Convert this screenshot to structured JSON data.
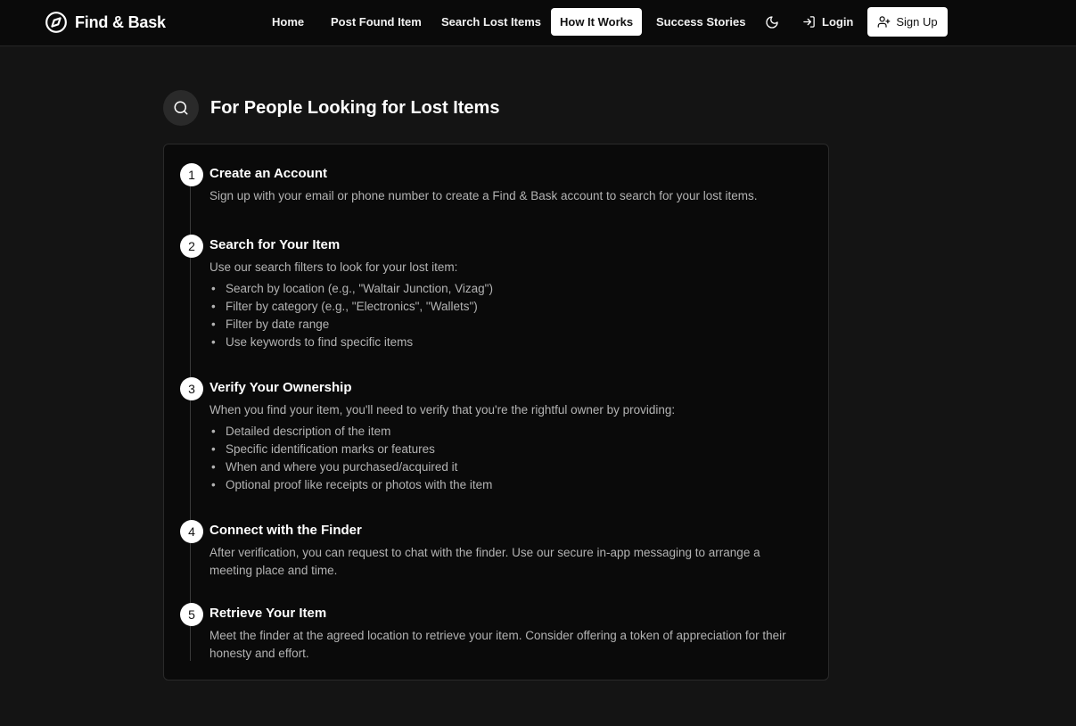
{
  "brand": {
    "name": "Find & Bask",
    "icon": "compass-icon"
  },
  "nav": {
    "items": [
      {
        "label": "Home"
      },
      {
        "label": "Post Found Item"
      },
      {
        "label": "Search Lost Items"
      },
      {
        "label": "How It Works",
        "active": true
      },
      {
        "label": "Success Stories"
      }
    ],
    "theme_toggle_icon": "moon-icon",
    "login_label": "Login",
    "login_icon": "log-in-icon",
    "signup_label": "Sign Up",
    "signup_icon": "user-plus-icon"
  },
  "section": {
    "icon": "search-icon",
    "title": "For People Looking for Lost Items"
  },
  "steps": [
    {
      "number": "1",
      "title": "Create an Account",
      "description": "Sign up with your email or phone number to create a Find & Bask account to search for your lost items.",
      "bullets": []
    },
    {
      "number": "2",
      "title": "Search for Your Item",
      "description": "Use our search filters to look for your lost item:",
      "bullets": [
        "Search by location (e.g., \"Waltair Junction, Vizag\")",
        "Filter by category (e.g., \"Electronics\", \"Wallets\")",
        "Filter by date range",
        "Use keywords to find specific items"
      ]
    },
    {
      "number": "3",
      "title": "Verify Your Ownership",
      "description": "When you find your item, you'll need to verify that you're the rightful owner by providing:",
      "bullets": [
        "Detailed description of the item",
        "Specific identification marks or features",
        "When and where you purchased/acquired it",
        "Optional proof like receipts or photos with the item"
      ]
    },
    {
      "number": "4",
      "title": "Connect with the Finder",
      "description": "After verification, you can request to chat with the finder. Use our secure in-app messaging to arrange a meeting place and time.",
      "bullets": []
    },
    {
      "number": "5",
      "title": "Retrieve Your Item",
      "description": "Meet the finder at the agreed location to retrieve your item. Consider offering a token of appreciation for their honesty and effort.",
      "bullets": []
    }
  ],
  "colors": {
    "page_bg": "#141414",
    "nav_bg": "#0a0a0a",
    "card_bg": "#0a0a0a",
    "accent": "#ffffff",
    "muted_text": "#b3b3b3"
  }
}
